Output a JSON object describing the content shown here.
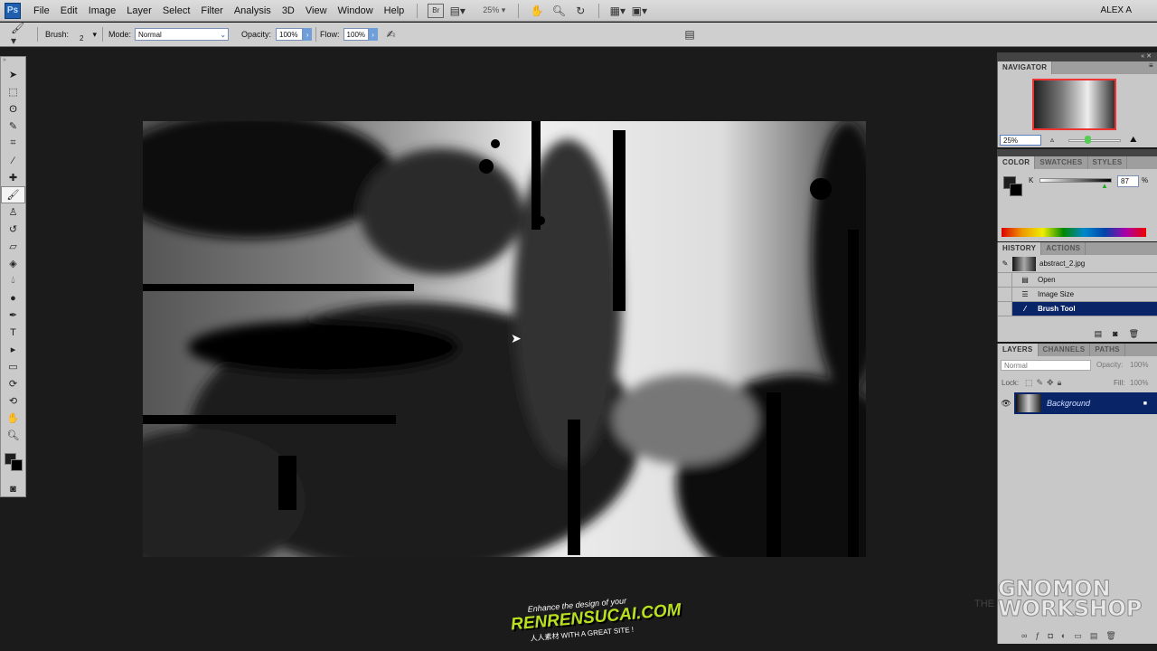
{
  "menubar": {
    "logo": "Ps",
    "items": [
      "File",
      "Edit",
      "Image",
      "Layer",
      "Select",
      "Filter",
      "Analysis",
      "3D",
      "View",
      "Window",
      "Help"
    ],
    "bridge": "Br",
    "zoom": "25%",
    "user": "ALEX A"
  },
  "options": {
    "brush_label": "Brush:",
    "brush_size": "2",
    "mode_label": "Mode:",
    "mode_value": "Normal",
    "opacity_label": "Opacity:",
    "opacity_value": "100%",
    "flow_label": "Flow:",
    "flow_value": "100%"
  },
  "navigator": {
    "title": "NAVIGATOR",
    "zoom": "25%"
  },
  "color": {
    "tabs": [
      "COLOR",
      "SWATCHES",
      "STYLES"
    ],
    "channel": "K",
    "value": "87",
    "unit": "%",
    "level": 0.87,
    "foreground": "#1e1e1e",
    "background": "#000000"
  },
  "history": {
    "tabs": [
      "HISTORY",
      "ACTIONS"
    ],
    "snapshot": "abstract_2.jpg",
    "steps": [
      "Open",
      "Image Size",
      "Brush Tool"
    ],
    "selected": 2
  },
  "layers": {
    "tabs": [
      "LAYERS",
      "CHANNELS",
      "PATHS"
    ],
    "blend": "Normal",
    "opacity_label": "Opacity:",
    "opacity": "100%",
    "lock_label": "Lock:",
    "fill_label": "Fill:",
    "fill": "100%",
    "items": [
      "Background"
    ]
  },
  "watermarks": {
    "renren_top": "Enhance the design of your",
    "renren_main": "RENRENSUCAI.COM",
    "renren_cn": "人人素材",
    "renren_sub": "WITH A GREAT SITE !",
    "gnomon_the": "THE",
    "gnomon_1": "GNOMON",
    "gnomon_2": "WORKSHOP"
  }
}
